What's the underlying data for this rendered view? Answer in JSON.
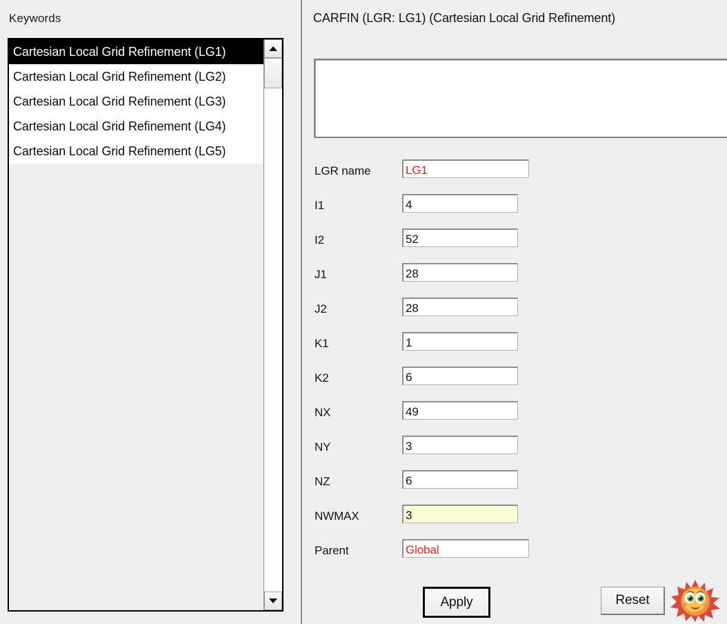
{
  "left": {
    "section_label": "Keywords",
    "list_items": [
      {
        "label": "Cartesian Local Grid Refinement (LG1)",
        "selected": true
      },
      {
        "label": "Cartesian Local Grid Refinement (LG2)",
        "selected": false
      },
      {
        "label": "Cartesian Local Grid Refinement (LG3)",
        "selected": false
      },
      {
        "label": "Cartesian Local Grid Refinement (LG4)",
        "selected": false
      },
      {
        "label": "Cartesian Local Grid Refinement (LG5)",
        "selected": false
      }
    ],
    "scrollbar": {
      "up_icon": "triangle-up-icon",
      "down_icon": "triangle-down-icon"
    }
  },
  "right": {
    "title": "CARFIN (LGR: LG1) (Cartesian Local Grid Refinement)",
    "comment_box_value": "",
    "fields": [
      {
        "label": "LGR name",
        "value": "LG1",
        "style": "red",
        "width": "wide"
      },
      {
        "label": "I1",
        "value": "4",
        "style": "normal",
        "width": "std"
      },
      {
        "label": "I2",
        "value": "52",
        "style": "normal",
        "width": "std"
      },
      {
        "label": "J1",
        "value": "28",
        "style": "normal",
        "width": "std"
      },
      {
        "label": "J2",
        "value": "28",
        "style": "normal",
        "width": "std"
      },
      {
        "label": "K1",
        "value": "1",
        "style": "normal",
        "width": "std"
      },
      {
        "label": "K2",
        "value": "6",
        "style": "normal",
        "width": "std"
      },
      {
        "label": "NX",
        "value": "49",
        "style": "normal",
        "width": "std"
      },
      {
        "label": "NY",
        "value": "3",
        "style": "normal",
        "width": "std"
      },
      {
        "label": "NZ",
        "value": "6",
        "style": "normal",
        "width": "std"
      },
      {
        "label": "NWMAX",
        "value": "3",
        "style": "highlight",
        "width": "std"
      },
      {
        "label": "Parent",
        "value": "Global",
        "style": "red",
        "width": "wide"
      }
    ],
    "buttons": {
      "apply_label": "Apply",
      "reset_label": "Reset"
    },
    "decoration": {
      "icon": "smiling-sun-icon",
      "body_color": "#f5a93c",
      "ray_color": "#d94a3e",
      "face_color": "#ffd24a"
    }
  }
}
